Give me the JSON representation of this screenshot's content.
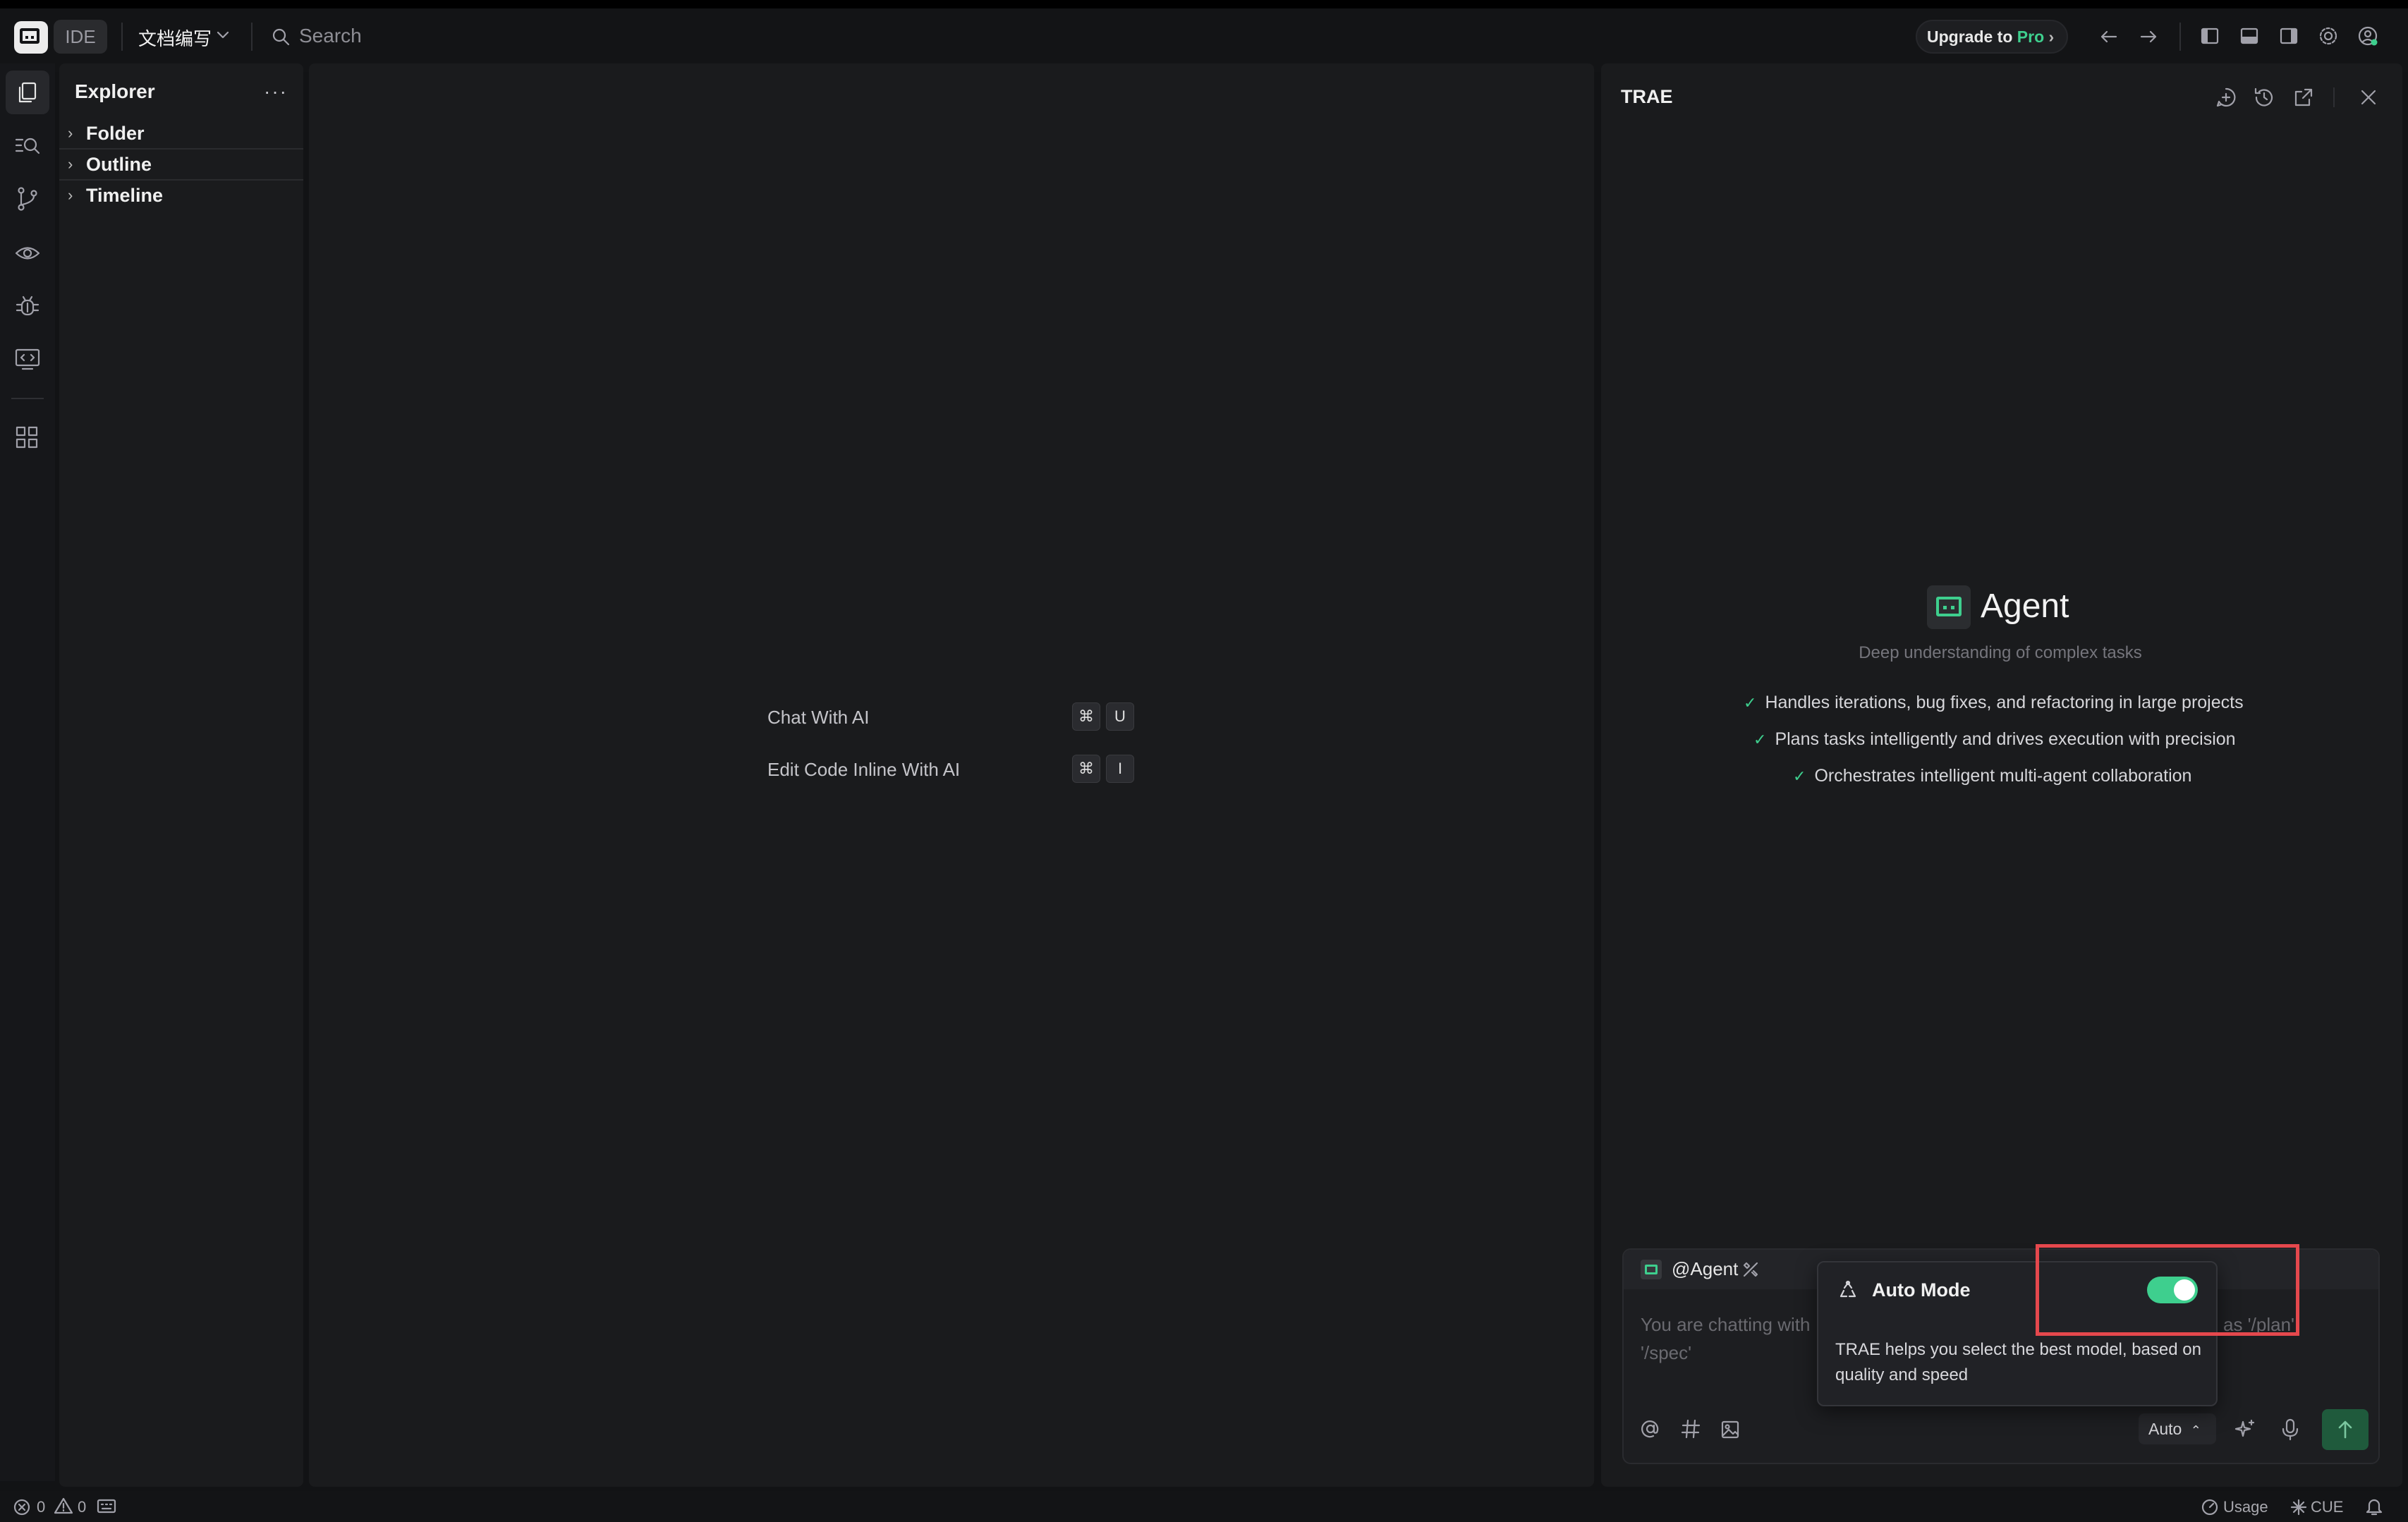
{
  "topbar": {
    "ide_label": "IDE",
    "workspace": "文档编写",
    "search_placeholder": "Search",
    "upgrade_text": "Upgrade to",
    "upgrade_pro": "Pro"
  },
  "explorer": {
    "title": "Explorer",
    "items": [
      {
        "label": "Folder"
      },
      {
        "label": "Outline"
      },
      {
        "label": "Timeline"
      }
    ]
  },
  "editor": {
    "hints": [
      {
        "label": "Chat With AI",
        "keys": [
          "⌘",
          "U"
        ]
      },
      {
        "label": "Edit Code Inline With AI",
        "keys": [
          "⌘",
          "I"
        ]
      }
    ]
  },
  "chat": {
    "title": "TRAE",
    "agent_title": "Agent",
    "agent_subtitle": "Deep understanding of complex tasks",
    "features": [
      "Handles iterations, bug fixes, and refactoring in large projects",
      "Plans tasks intelligently and drives execution with precision",
      "Orchestrates intelligent multi-agent collaboration"
    ],
    "input": {
      "agent_tag": "@Agent",
      "placeholder_left": "You are chatting with",
      "placeholder_right": "as '/plan',",
      "placeholder_line2": "'/spec'",
      "model_label": "Auto"
    }
  },
  "popover": {
    "title": "Auto Mode",
    "description": "TRAE helps you select the best model, based on quality and speed",
    "toggle_on": true
  },
  "statusbar": {
    "errors": "0",
    "warnings": "0",
    "usage": "Usage",
    "cue": "CUE"
  },
  "colors": {
    "accent": "#3ecf8e",
    "highlight": "#e5484d"
  }
}
